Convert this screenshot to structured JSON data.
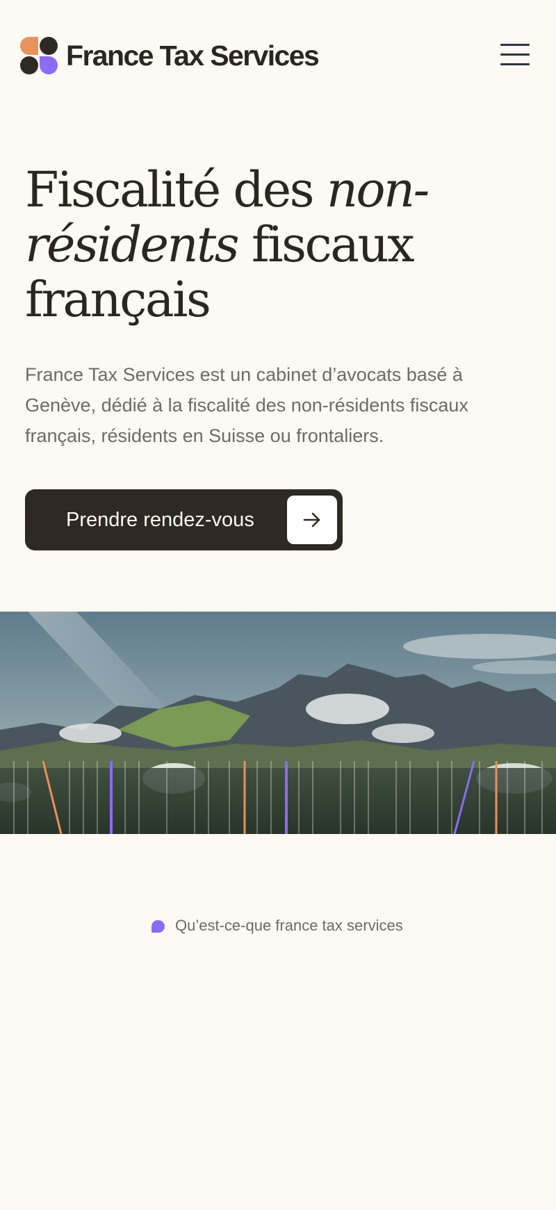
{
  "header": {
    "brand": "France Tax Services",
    "logo_icon": "four-dot-logo-icon",
    "menu_icon": "hamburger-menu-icon"
  },
  "hero": {
    "title_part1": "Fiscalité des ",
    "title_italic1": "non-",
    "title_italic2": "résidents",
    "title_part2": " fiscaux",
    "title_part3": "français",
    "description": "France Tax Services est un cabinet d’avocats basé à Genève, dédié à la fiscalité des non-résidents fiscaux français, résidents en Suisse ou frontaliers.",
    "cta_label": "Prendre rendez-vous",
    "cta_icon": "arrow-right-icon"
  },
  "banner": {
    "image": "mountain-landscape-image"
  },
  "section": {
    "eyebrow": "Qu’est-ce-que france tax services"
  },
  "colors": {
    "background": "#fdfaf3",
    "dark": "#2e2923",
    "accent_orange": "#e8925e",
    "accent_purple": "#8b6cf2",
    "muted_text": "#6e6a64"
  }
}
